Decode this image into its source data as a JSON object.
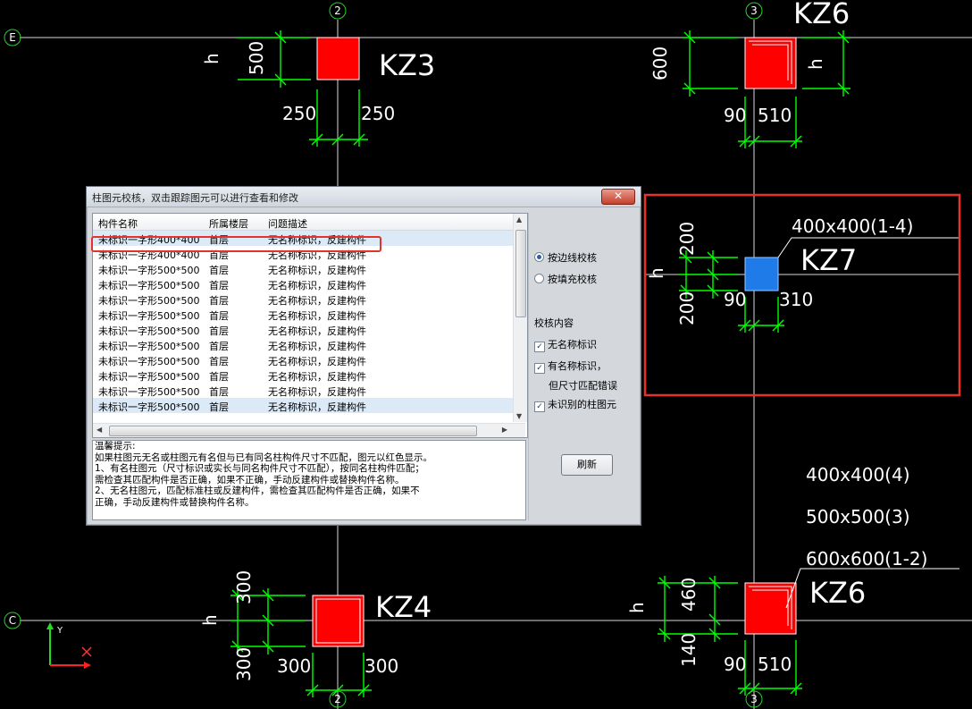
{
  "cad": {
    "axes": {
      "e": "E",
      "c": "C",
      "col2": "2",
      "col3": "3"
    },
    "ucs": {
      "y": "Y"
    },
    "kz3": {
      "name": "KZ3",
      "h_label": "h",
      "dim_h": "500",
      "dim_left": "250",
      "dim_right": "250"
    },
    "kz6_top": {
      "name": "KZ6",
      "h_label": "h",
      "dim_h": "600",
      "dim_left": "90",
      "dim_right": "510"
    },
    "kz7": {
      "name": "KZ7",
      "size_label": "400x400(1-4)",
      "h_label": "h",
      "dim_top": "200",
      "dim_bottom": "200",
      "dim_left": "90",
      "dim_right": "310"
    },
    "legend": {
      "line1": "400x400(4)",
      "line2": "500x500(3)",
      "line3": "600x600(1-2)"
    },
    "kz6_bottom": {
      "name": "KZ6",
      "h_label": "h",
      "dim_top": "460",
      "dim_bottom": "140",
      "dim_left": "90",
      "dim_right": "510"
    },
    "kz4": {
      "name": "KZ4",
      "h_label": "h",
      "dim_top": "300",
      "dim_bottom": "300",
      "dim_left": "300",
      "dim_right": "300"
    },
    "colors": {
      "column": "#ff0000",
      "highlight_column": "#1e7be8",
      "dim": "#00ff00",
      "grid": "#ffffff",
      "annotation": "#e5332a"
    }
  },
  "dialog": {
    "title": "柱图元校核，双击跟踪图元可以进行查看和修改",
    "close": "✕",
    "columns": [
      "构件名称",
      "所属楼层",
      "问题描述"
    ],
    "rows": [
      {
        "name": "未标识一字形400*400",
        "floor": "首层",
        "issue": "无名称标识，反建构件"
      },
      {
        "name": "未标识一字形400*400",
        "floor": "首层",
        "issue": "无名称标识，反建构件"
      },
      {
        "name": "未标识一字形500*500",
        "floor": "首层",
        "issue": "无名称标识，反建构件"
      },
      {
        "name": "未标识一字形500*500",
        "floor": "首层",
        "issue": "无名称标识，反建构件"
      },
      {
        "name": "未标识一字形500*500",
        "floor": "首层",
        "issue": "无名称标识，反建构件"
      },
      {
        "name": "未标识一字形500*500",
        "floor": "首层",
        "issue": "无名称标识，反建构件"
      },
      {
        "name": "未标识一字形500*500",
        "floor": "首层",
        "issue": "无名称标识，反建构件"
      },
      {
        "name": "未标识一字形500*500",
        "floor": "首层",
        "issue": "无名称标识，反建构件"
      },
      {
        "name": "未标识一字形500*500",
        "floor": "首层",
        "issue": "无名称标识，反建构件"
      },
      {
        "name": "未标识一字形500*500",
        "floor": "首层",
        "issue": "无名称标识，反建构件"
      },
      {
        "name": "未标识一字形500*500",
        "floor": "首层",
        "issue": "无名称标识，反建构件"
      },
      {
        "name": "未标识一字形500*500",
        "floor": "首层",
        "issue": "无名称标识，反建构件"
      }
    ],
    "options": {
      "radio1": "按边线校核",
      "radio2": "按填充校核",
      "section": "校核内容",
      "chk1": "无名称标识",
      "chk2a": "有名称标识，",
      "chk2b": "但尺寸匹配错误",
      "chk3": "未识别的柱图元",
      "check_mark": "✓"
    },
    "refresh": "刷新",
    "tips": [
      "温馨提示:",
      "如果柱图元无名或柱图元有名但与已有同名柱构件尺寸不匹配，图元以红色显示。",
      "1、有名柱图元（尺寸标识或实长与同名构件尺寸不匹配），按同名柱构件匹配；",
      "需检查其匹配构件是否正确，如果不正确，手动反建构件或替换构件名称。",
      "2、无名柱图元，匹配标准柱或反建构件，需检查其匹配构件是否正确，如果不",
      "正确，手动反建构件或替换构件名称。"
    ]
  }
}
